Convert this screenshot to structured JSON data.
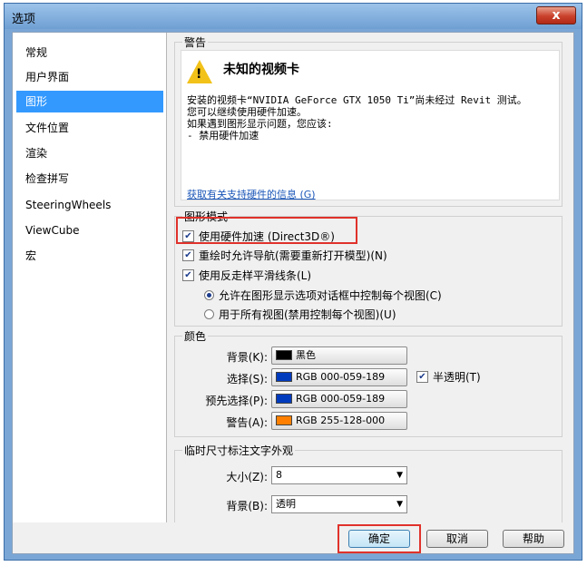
{
  "window": {
    "title": "选项",
    "close": "x"
  },
  "sidebar": {
    "items": [
      {
        "label": "常规",
        "selected": false
      },
      {
        "label": "用户界面",
        "selected": false
      },
      {
        "label": "图形",
        "selected": true
      },
      {
        "label": "文件位置",
        "selected": false
      },
      {
        "label": "渲染",
        "selected": false
      },
      {
        "label": "检查拼写",
        "selected": false
      },
      {
        "label": "SteeringWheels",
        "selected": false
      },
      {
        "label": "ViewCube",
        "selected": false
      },
      {
        "label": "宏",
        "selected": false
      }
    ]
  },
  "warning": {
    "group_title": "警告",
    "heading": "未知的视频卡",
    "lines": [
      "安装的视频卡“NVIDIA GeForce GTX 1050 Ti”尚未经过 Revit 测试。",
      "您可以继续使用硬件加速。",
      "如果遇到图形显示问题，您应该:",
      "      - 禁用硬件加速"
    ],
    "link": "获取有关支持硬件的信息 (G)"
  },
  "graphics_mode": {
    "group_title": "图形模式",
    "hw_accel": {
      "label": "使用硬件加速 (Direct3D®)",
      "checked": true
    },
    "redraw_nav": {
      "label": "重绘时允许导航(需要重新打开模型)(N)",
      "checked": true
    },
    "antialias": {
      "label": "使用反走样平滑线条(L)",
      "checked": true
    },
    "radio_each": {
      "label": "允许在图形显示选项对话框中控制每个视图(C)",
      "selected": true
    },
    "radio_all": {
      "label": "用于所有视图(禁用控制每个视图)(U)",
      "selected": false
    }
  },
  "colors": {
    "group_title": "颜色",
    "background": {
      "label": "背景(K):",
      "value": "黑色",
      "swatch": "#000000"
    },
    "selection": {
      "label": "选择(S):",
      "value": "RGB 000-059-189",
      "swatch": "#003bbd"
    },
    "semi_transparent": {
      "label": "半透明(T)",
      "checked": true
    },
    "preselection": {
      "label": "预先选择(P):",
      "value": "RGB 000-059-189",
      "swatch": "#003bbd"
    },
    "alert": {
      "label": "警告(A):",
      "value": "RGB 255-128-000",
      "swatch": "#ff8000"
    }
  },
  "temp_dims": {
    "group_title": "临时尺寸标注文字外观",
    "size": {
      "label": "大小(Z):",
      "value": "8"
    },
    "background": {
      "label": "背景(B):",
      "value": "透明"
    }
  },
  "buttons": {
    "ok": "确定",
    "cancel": "取消",
    "help": "帮助"
  },
  "colors_meta": {
    "selected_item_bg": "#3399ff",
    "highlight_red": "#e0322b"
  }
}
